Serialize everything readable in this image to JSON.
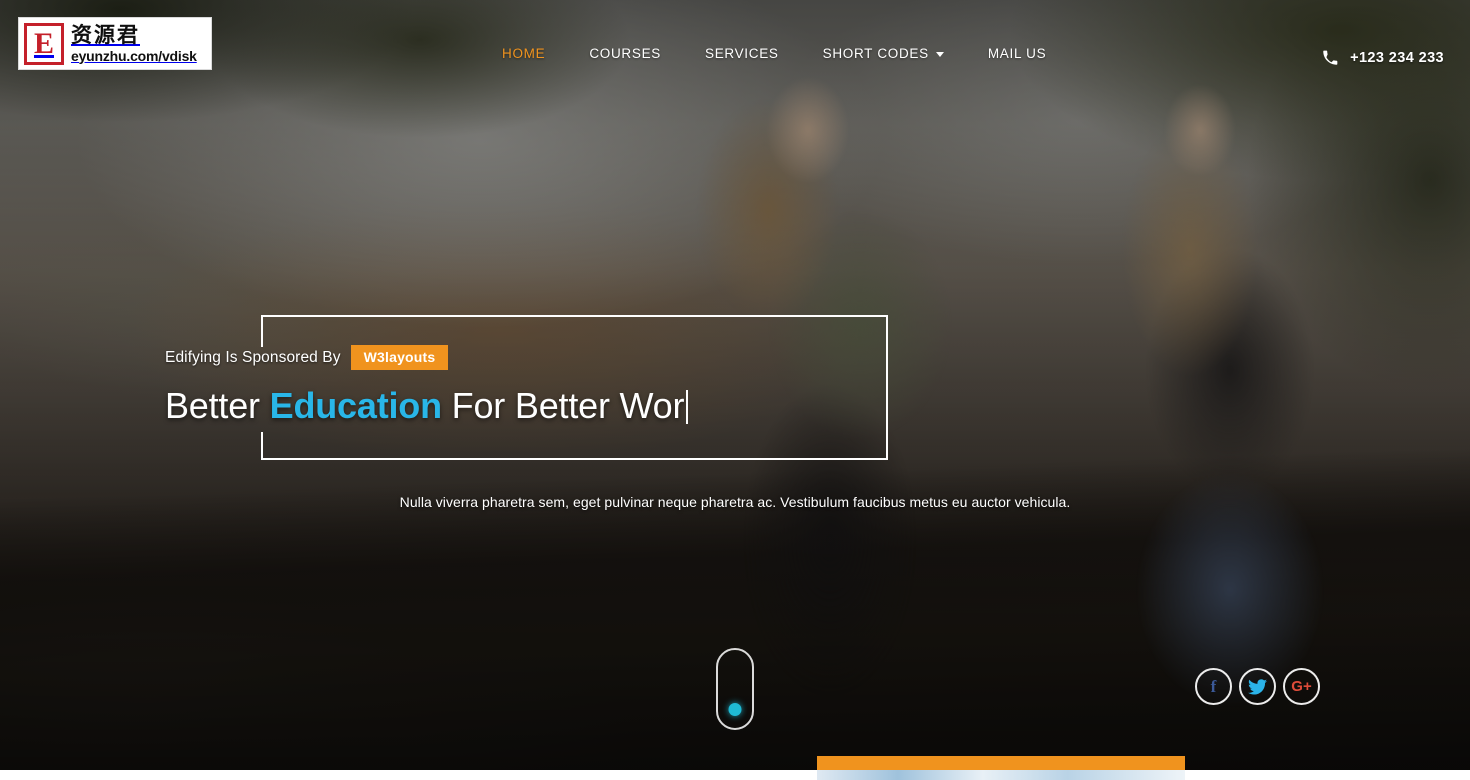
{
  "site": {
    "logo": {
      "mark": "E",
      "name_cn": "资源君",
      "url": "eyunzhu.com/vdisk"
    }
  },
  "header": {
    "nav_items": [
      {
        "label": "HOME",
        "active": true,
        "has_dropdown": false
      },
      {
        "label": "COURSES",
        "active": false,
        "has_dropdown": false
      },
      {
        "label": "SERVICES",
        "active": false,
        "has_dropdown": false
      },
      {
        "label": "SHORT CODES",
        "active": false,
        "has_dropdown": true
      },
      {
        "label": "MAIL US",
        "active": false,
        "has_dropdown": false
      }
    ],
    "phone": {
      "icon": "phone-icon",
      "number": "+123 234 233"
    }
  },
  "hero": {
    "sponsor_label": "Edifying Is Sponsored By",
    "sponsor_badge": "W3layouts",
    "title_prefix": "Better ",
    "title_accent": "Education",
    "title_suffix": " For Better Wor",
    "subtitle": "Nulla viverra pharetra sem, eget pulvinar neque pharetra ac. Vestibulum faucibus metus eu auctor vehicula.",
    "scroll_indicator": "scroll-mouse-icon"
  },
  "socials": [
    {
      "name": "facebook-icon",
      "glyph": "f",
      "color": "#3b5998"
    },
    {
      "name": "twitter-icon",
      "glyph": "🐦",
      "color": "#2bb3e8"
    },
    {
      "name": "google-plus-icon",
      "glyph": "G+",
      "color": "#dd4b39"
    }
  ],
  "colors": {
    "accent_orange": "#f0931e",
    "accent_cyan": "#29b6e8",
    "scroll_dot": "#1fbad4",
    "text_light": "#ffffff"
  }
}
